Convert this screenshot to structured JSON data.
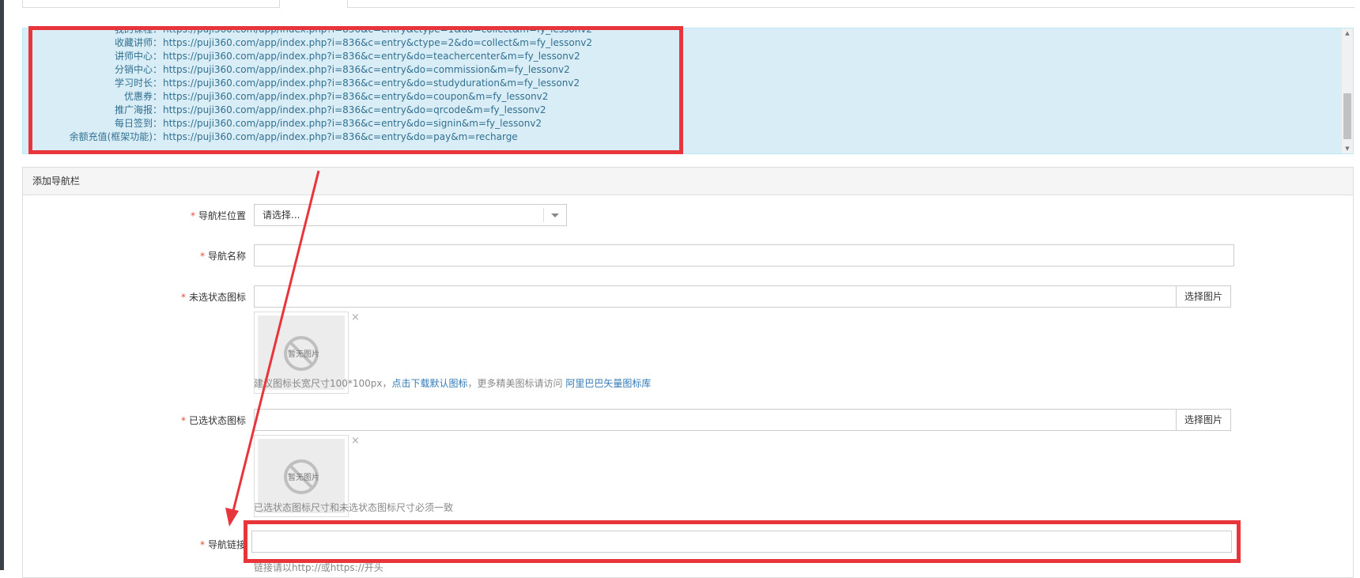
{
  "links": {
    "rows": [
      {
        "label": "收藏讲师：",
        "url": "https://puji360.com/app/index.php?i=836&c=entry&ctype=2&do=collect&m=fy_lessonv2"
      },
      {
        "label": "讲师中心：",
        "url": "https://puji360.com/app/index.php?i=836&c=entry&do=teachercenter&m=fy_lessonv2"
      },
      {
        "label": "分销中心：",
        "url": "https://puji360.com/app/index.php?i=836&c=entry&do=commission&m=fy_lessonv2"
      },
      {
        "label": "学习时长：",
        "url": "https://puji360.com/app/index.php?i=836&c=entry&do=studyduration&m=fy_lessonv2"
      },
      {
        "label": "优惠券：",
        "url": "https://puji360.com/app/index.php?i=836&c=entry&do=coupon&m=fy_lessonv2"
      },
      {
        "label": "推广海报：",
        "url": "https://puji360.com/app/index.php?i=836&c=entry&do=qrcode&m=fy_lessonv2"
      },
      {
        "label": "每日签到：",
        "url": "https://puji360.com/app/index.php?i=836&c=entry&do=signin&m=fy_lessonv2"
      },
      {
        "label": "余额充值(框架功能)：",
        "url": "https://puji360.com/app/index.php?i=836&c=entry&do=pay&m=recharge"
      }
    ]
  },
  "panel": {
    "title": "添加导航栏"
  },
  "form": {
    "required_mark": "*",
    "position": {
      "label": "导航栏位置",
      "selected": "请选择..."
    },
    "name": {
      "label": "导航名称",
      "value": ""
    },
    "unselected_icon": {
      "label": "未选状态图标",
      "value": "",
      "button": "选择图片",
      "placeholder_image_text": "暂无图片",
      "remove": "×",
      "help_prefix": "建议图标长宽尺寸100*100px，",
      "help_link1": "点击下载默认图标",
      "help_middle": "，更多精美图标请访问 ",
      "help_link2": "阿里巴巴矢量图标库"
    },
    "selected_icon": {
      "label": "已选状态图标",
      "value": "",
      "button": "选择图片",
      "placeholder_image_text": "暂无图片",
      "remove": "×",
      "help": "已选状态图标尺寸和未选状态图标尺寸必须一致"
    },
    "link": {
      "label": "导航链接",
      "value": "",
      "help": "链接请以http://或https://开头"
    }
  },
  "colors": {
    "annotation_red": "#e8353b",
    "info_bg": "#d9edf7",
    "info_text": "#31708f",
    "link_blue": "#337ab7"
  }
}
